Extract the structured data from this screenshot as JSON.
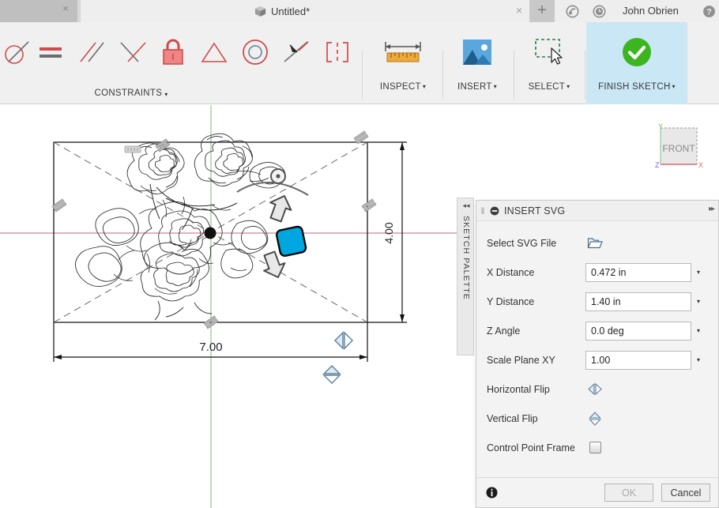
{
  "window": {
    "doc_tab_close": "×",
    "doc_title": "Untitled*",
    "doc_title_icon": "cube-icon",
    "tab_close": "×",
    "new_tab": "+",
    "user_name": "John Obrien",
    "help_icon": "help-icon",
    "job_status_icon": "job-status-icon",
    "recent_icon": "clock-icon"
  },
  "ribbon": {
    "constraints": {
      "label": "CONSTRAINTS",
      "caret": "▾",
      "icons": [
        "tangent-constraint-icon",
        "equal-constraint-icon",
        "parallel-constraint-icon",
        "perpendicular-constraint-icon",
        "fix-unfix-constraint-icon",
        "symmetry-constraint-icon",
        "concentric-constraint-icon",
        "midpoint-constraint-icon",
        "curvature-constraint-icon"
      ]
    },
    "commands": [
      {
        "label": "INSPECT",
        "caret": "▾",
        "icon": "measure-icon"
      },
      {
        "label": "INSERT",
        "caret": "▾",
        "icon": "insert-image-icon"
      },
      {
        "label": "SELECT",
        "caret": "▾",
        "icon": "select-window-icon"
      },
      {
        "label": "FINISH SKETCH",
        "caret": "▾",
        "icon": "finish-sketch-check-icon"
      }
    ],
    "finish_highlight_color": "#c9e7f5"
  },
  "canvas": {
    "dimension_width": "7.00",
    "dimension_height": "4.00",
    "viewcube_face": "FRONT",
    "axis_x": "X",
    "axis_y": "Y",
    "axis_z": "Z",
    "origin_point": "sketch-origin-point",
    "artwork": "floral-line-art-svg"
  },
  "sketch_palette": {
    "label": "SKETCH PALETTE",
    "collapse_arrows": "◂◂"
  },
  "insert_svg_dialog": {
    "title": "INSERT SVG",
    "grip": "‖",
    "collapse_icon": "collapse-circle-icon",
    "expand_icon": "▸▸",
    "rows": [
      {
        "label": "Select SVG File",
        "type": "file",
        "icon": "open-folder-icon"
      },
      {
        "label": "X Distance",
        "type": "input",
        "value": "0.472 in",
        "caret": "▾"
      },
      {
        "label": "Y Distance",
        "type": "input",
        "value": "1.40 in",
        "caret": "▾"
      },
      {
        "label": "Z Angle",
        "type": "input",
        "value": "0.0 deg",
        "caret": "▾"
      },
      {
        "label": "Scale Plane XY",
        "type": "input",
        "value": "1.00",
        "caret": "▾"
      },
      {
        "label": "Horizontal Flip",
        "type": "icon",
        "icon": "horizontal-flip-icon"
      },
      {
        "label": "Vertical Flip",
        "type": "icon",
        "icon": "vertical-flip-icon"
      },
      {
        "label": "Control Point Frame",
        "type": "checkbox",
        "checked": false
      }
    ],
    "info_icon": "info-icon",
    "ok_label": "OK",
    "ok_enabled": false,
    "cancel_label": "Cancel"
  },
  "colors": {
    "accent_blue": "#00a6e0",
    "constraint_red": "#cf4b4b",
    "finish_green": "#3cb521",
    "panel_bg": "#f3f3f3",
    "ribbon_bg": "#f0f0f0",
    "axis_red": "#c06a7a",
    "axis_green": "#7ab87a"
  }
}
